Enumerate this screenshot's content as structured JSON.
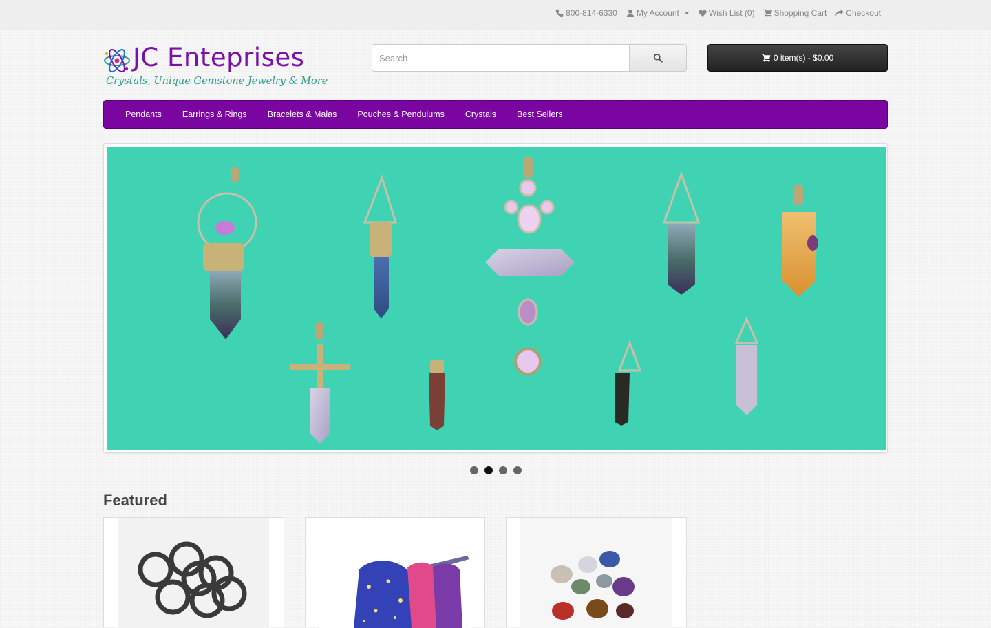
{
  "topbar": {
    "phone": "800-814-6330",
    "my_account": "My Account",
    "wish_list": "Wish List (0)",
    "shopping_cart": "Shopping Cart",
    "checkout": "Checkout"
  },
  "logo": {
    "title": "JC Enteprises",
    "tagline": "Crystals, Unique Gemstone Jewelry & More"
  },
  "search": {
    "placeholder": "Search",
    "icon": "search-icon"
  },
  "cart": {
    "label": "0 item(s) - $0.00",
    "icon": "cart-icon"
  },
  "menu": {
    "items": [
      {
        "label": "Pendants"
      },
      {
        "label": "Earrings & Rings"
      },
      {
        "label": "Bracelets & Malas"
      },
      {
        "label": "Pouches & Pendulums"
      },
      {
        "label": "Crystals"
      },
      {
        "label": "Best Sellers"
      }
    ]
  },
  "slideshow": {
    "slide_count": 4,
    "active_slide": 2
  },
  "featured": {
    "title": "Featured",
    "products": [
      "hematite-rings",
      "star-pouches",
      "tumbled-stones"
    ]
  },
  "colors": {
    "brand_purple": "#7b05a0",
    "tagline_teal": "#2a9e88",
    "slide_background": "#3fd3b4"
  }
}
